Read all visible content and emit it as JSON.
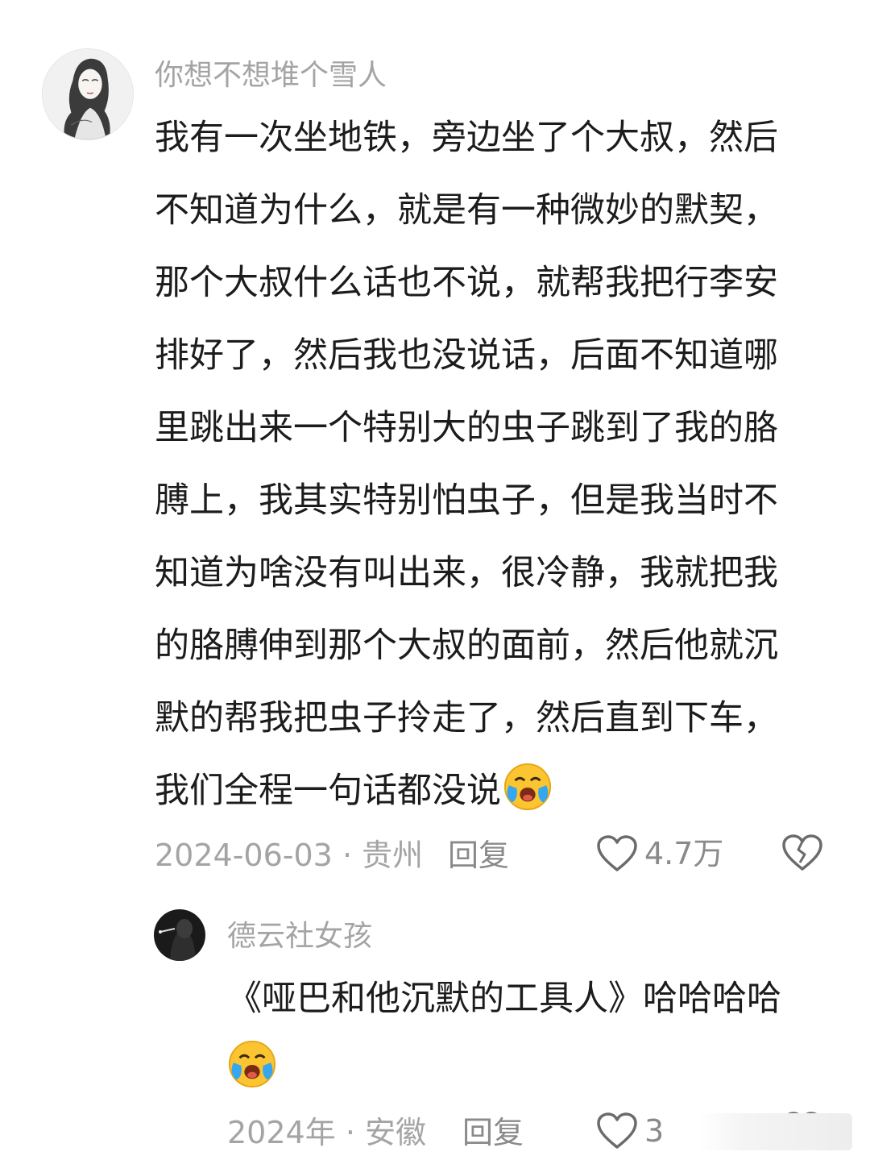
{
  "comments": [
    {
      "username": "你想不想堆个雪人",
      "avatar": "avatar-sketch-girl",
      "lines": [
        "我有一次坐地铁，旁边坐了个大叔，然后",
        "不知道为什么，就是有一种微妙的默契，",
        "那个大叔什么话也不说，就帮我把行李安",
        "排好了，然后我也没说话，后面不知道哪",
        "里跳出来一个特别大的虫子跳到了我的胳",
        "膊上，我其实特别怕虫子，但是我当时不",
        "知道为啥没有叫出来，很冷静，我就把我",
        "的胳膊伸到那个大叔的面前，然后他就沉",
        "默的帮我把虫子拎走了，然后直到下车，",
        "我们全程一句话都没说"
      ],
      "emoji": "laugh-cry-emoji",
      "date": "2024-06-03",
      "location": "贵州",
      "reply_label": "回复",
      "like_count": "4.7万"
    },
    {
      "username": "德云社女孩",
      "avatar": "avatar-dark-photo",
      "lines": [
        "《哑巴和他沉默的工具人》哈哈哈哈"
      ],
      "emoji": "laugh-cry-emoji",
      "date": "2024年",
      "location": "安徽",
      "reply_label": "回复",
      "like_count": "3"
    }
  ],
  "colors": {
    "text": "#1c1c1c",
    "muted": "#a4a4a4",
    "action": "#8a8a8a",
    "background": "#ffffff"
  }
}
